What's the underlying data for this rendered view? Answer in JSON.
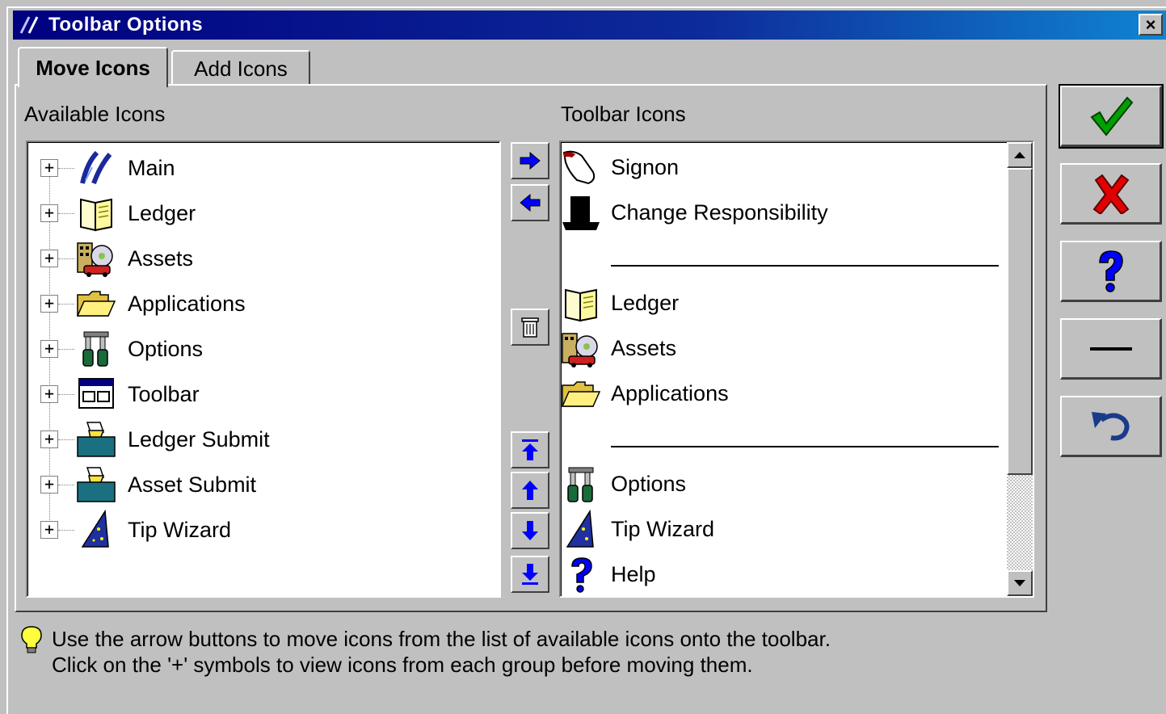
{
  "window": {
    "title": "Toolbar Options",
    "close_label": "×"
  },
  "tabs": [
    {
      "label": "Move Icons",
      "active": true
    },
    {
      "label": "Add Icons",
      "active": false
    }
  ],
  "available": {
    "label": "Available Icons",
    "items": [
      {
        "label": "Main",
        "icon": "main-icon",
        "expander": "+"
      },
      {
        "label": "Ledger",
        "icon": "ledger-book-icon",
        "expander": "+"
      },
      {
        "label": "Assets",
        "icon": "assets-icon",
        "expander": "+"
      },
      {
        "label": "Applications",
        "icon": "folder-icon",
        "expander": "+"
      },
      {
        "label": "Options",
        "icon": "tools-icon",
        "expander": "+"
      },
      {
        "label": "Toolbar",
        "icon": "toolbar-icon",
        "expander": "+"
      },
      {
        "label": "Ledger Submit",
        "icon": "submit-tray-icon",
        "expander": "+"
      },
      {
        "label": "Asset Submit",
        "icon": "submit-tray-icon",
        "expander": "+"
      },
      {
        "label": "Tip Wizard",
        "icon": "wizard-hat-icon",
        "expander": "+"
      }
    ]
  },
  "toolbar": {
    "label": "Toolbar Icons",
    "items": [
      {
        "type": "item",
        "label": "Signon",
        "icon": "signon-hand-icon"
      },
      {
        "type": "item",
        "label": "Change Responsibility",
        "icon": "black-hat-icon"
      },
      {
        "type": "separator"
      },
      {
        "type": "item",
        "label": "Ledger",
        "icon": "ledger-book-icon"
      },
      {
        "type": "item",
        "label": "Assets",
        "icon": "assets-icon"
      },
      {
        "type": "item",
        "label": "Applications",
        "icon": "folder-icon"
      },
      {
        "type": "separator"
      },
      {
        "type": "item",
        "label": "Options",
        "icon": "tools-icon"
      },
      {
        "type": "item",
        "label": "Tip Wizard",
        "icon": "wizard-hat-icon"
      },
      {
        "type": "item",
        "label": "Help",
        "icon": "help-icon"
      }
    ]
  },
  "hint": {
    "line1": "Use the arrow buttons to move icons from the list of available icons onto the toolbar.",
    "line2": "Click on the '+' symbols to view icons from each group before moving them."
  },
  "colors": {
    "face": "#c0c0c0",
    "title_start": "#000080",
    "title_end": "#1084d0",
    "arrow_blue": "#0000ff",
    "ok_green": "#00a000",
    "cancel_red": "#e00000"
  }
}
